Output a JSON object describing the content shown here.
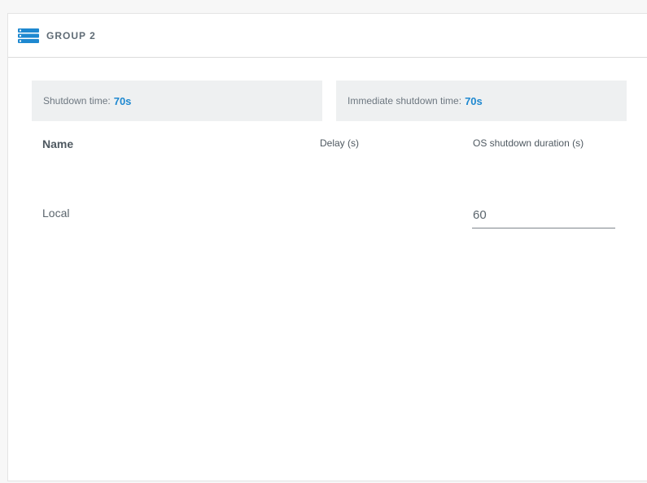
{
  "group": {
    "title": "GROUP 2",
    "icon": "server-list-icon",
    "accent_color": "#1e88d0"
  },
  "summary": {
    "shutdown_label": "Shutdown time:",
    "shutdown_value": "70s",
    "immediate_label": "Immediate shutdown time:",
    "immediate_value": "70s"
  },
  "table": {
    "columns": [
      "Name",
      "Delay (s)",
      "OS shutdown duration (s)"
    ],
    "rows": [
      {
        "name": "Local",
        "delay": "",
        "os_shutdown_duration": "60"
      }
    ]
  }
}
